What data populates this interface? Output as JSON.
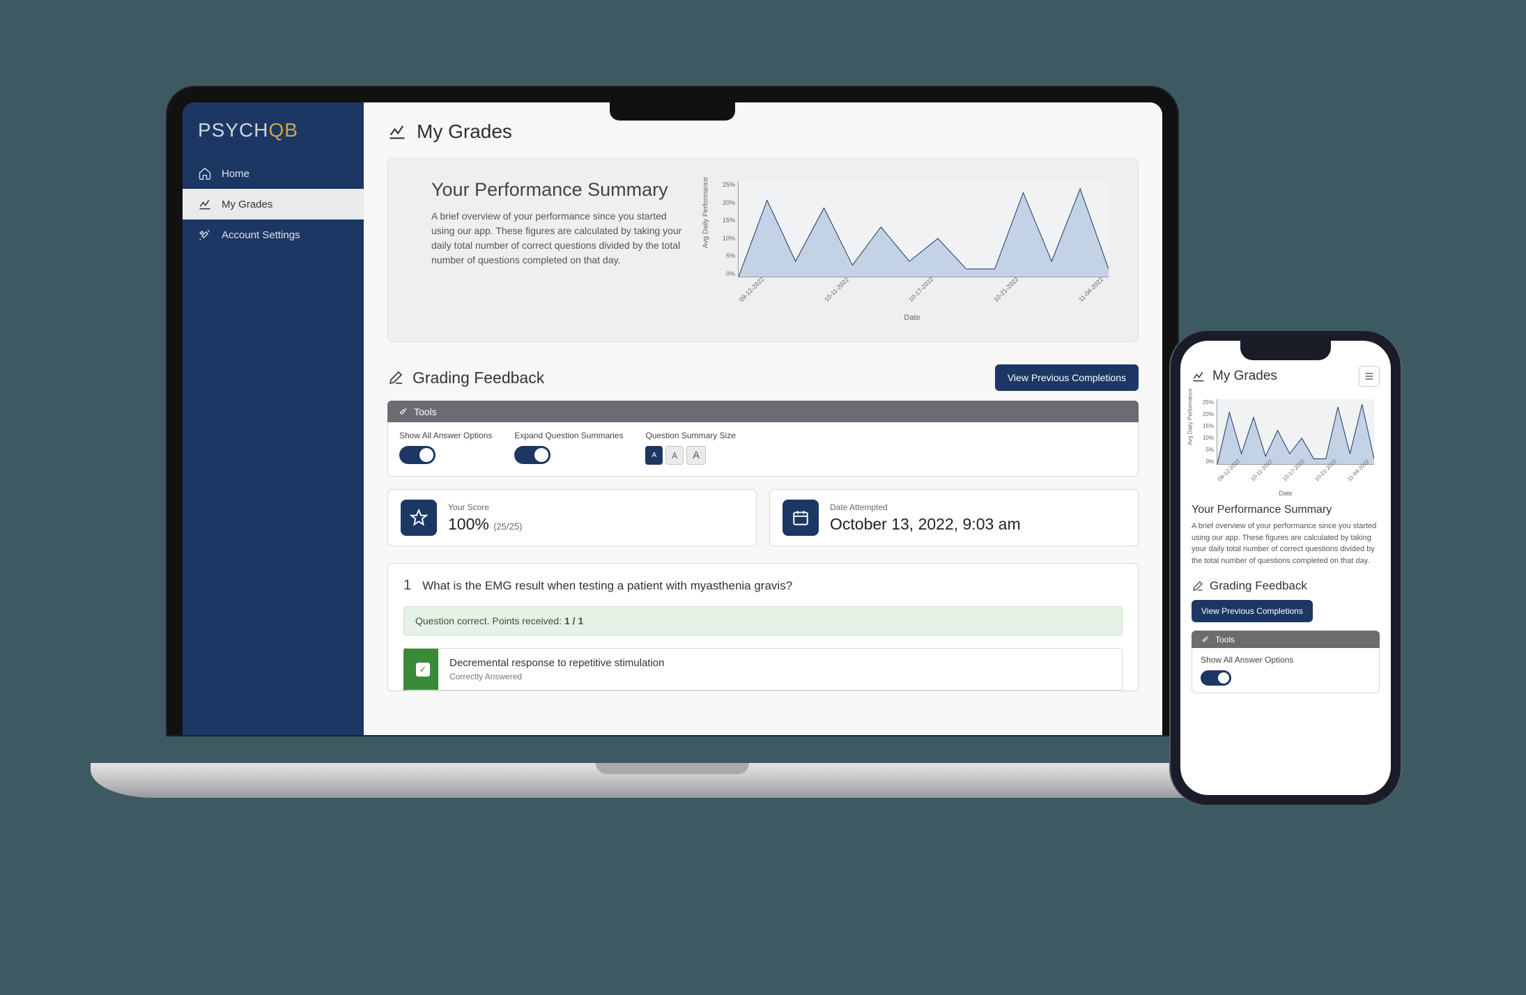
{
  "brand": {
    "part1": "PSYCH",
    "part2": "QB"
  },
  "sidebar": {
    "items": [
      {
        "label": "Home"
      },
      {
        "label": "My Grades"
      },
      {
        "label": "Account Settings"
      }
    ]
  },
  "page": {
    "title": "My Grades"
  },
  "summary": {
    "heading": "Your Performance Summary",
    "body": "A brief overview of your performance since you started using our app. These figures are calculated by taking your daily total number of correct questions divided by the total number of questions completed on that day."
  },
  "chart_data": {
    "type": "area",
    "title": "",
    "xlabel": "Date",
    "ylabel": "Avg Daily Performance",
    "ylim": [
      0,
      25
    ],
    "yticks": [
      "25%",
      "20%",
      "15%",
      "10%",
      "5%",
      "0%"
    ],
    "categories": [
      "09-12-2022",
      "10-11-2022",
      "10-17-2022",
      "10-21-2022",
      "11-04-2022"
    ],
    "values": [
      0,
      20,
      4,
      18,
      3,
      13,
      4,
      10,
      2,
      2,
      22,
      4,
      23,
      2
    ]
  },
  "feedback": {
    "heading": "Grading Feedback",
    "view_previous": "View Previous Completions",
    "tools_label": "Tools",
    "tool_show_all": "Show All Answer Options",
    "tool_expand": "Expand Question Summaries",
    "tool_size": "Question Summary Size",
    "size_letter": "A"
  },
  "score": {
    "label": "Your Score",
    "value": "100%",
    "sub": "(25/25)"
  },
  "date": {
    "label": "Date Attempted",
    "value": "October 13, 2022, 9:03 am"
  },
  "question": {
    "number": "1",
    "text": "What is the EMG result when testing a patient with myasthenia gravis?",
    "correct_banner_prefix": "Question correct. Points received: ",
    "correct_banner_points": "1 / 1",
    "answer_text": "Decremental response to repetitive stimulation",
    "answer_sub": "Correctly Answered"
  },
  "phone": {
    "tool_show_all": "Show All Answer Options"
  }
}
